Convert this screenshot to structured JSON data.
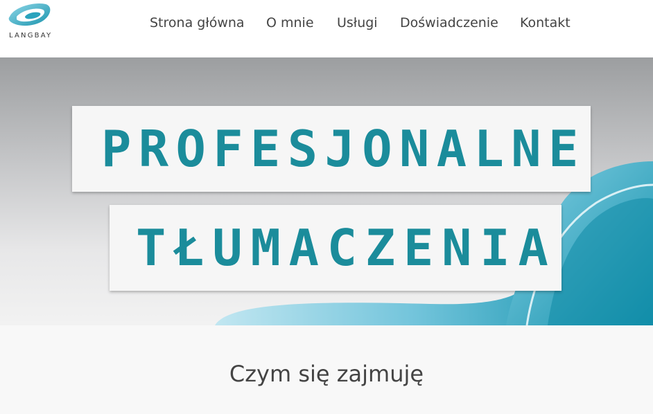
{
  "logo": {
    "text": "LANGBAY",
    "icon": "langbay-swirl-logo"
  },
  "nav": {
    "items": [
      {
        "label": "Strona główna"
      },
      {
        "label": "O mnie"
      },
      {
        "label": "Usługi"
      },
      {
        "label": "Doświadczenie"
      },
      {
        "label": "Kontakt"
      }
    ]
  },
  "hero": {
    "line1": "PROFESJONALNE",
    "line2": "TŁUMACZENIA"
  },
  "section": {
    "title": "Czym się zajmuję"
  },
  "colors": {
    "accent": "#1b8c9b",
    "nav_text": "#444444",
    "swirl_light": "#8fd3e6",
    "swirl_dark": "#1f9ab2"
  }
}
